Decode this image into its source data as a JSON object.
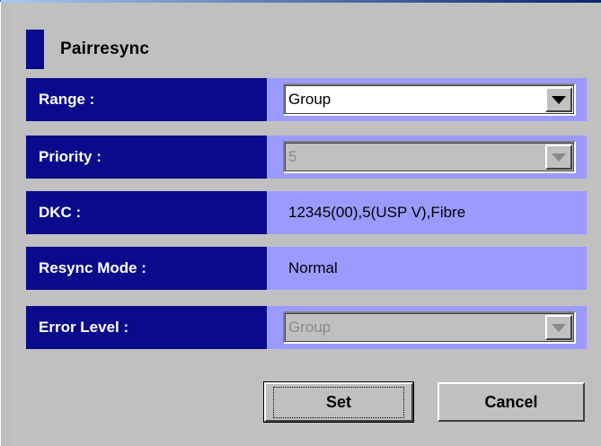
{
  "dialog": {
    "title": "Pairresync"
  },
  "fields": {
    "range": {
      "label": "Range :",
      "value": "Group"
    },
    "priority": {
      "label": "Priority :",
      "value": "5"
    },
    "dkc": {
      "label": "DKC :",
      "value": "12345(00),5(USP V),Fibre"
    },
    "resync_mode": {
      "label": "Resync Mode :",
      "value": "Normal"
    },
    "error_level": {
      "label": "Error Level :",
      "value": "Group"
    }
  },
  "buttons": {
    "set_label": "Set",
    "cancel_label": "Cancel"
  },
  "icons": {
    "dropdown": "chevron-down-icon",
    "header_marker": "section-marker-icon"
  },
  "colors": {
    "label_bg": "#0a0a8c",
    "value_bg": "#9b9bff",
    "window_bg": "#c0c0c0"
  }
}
